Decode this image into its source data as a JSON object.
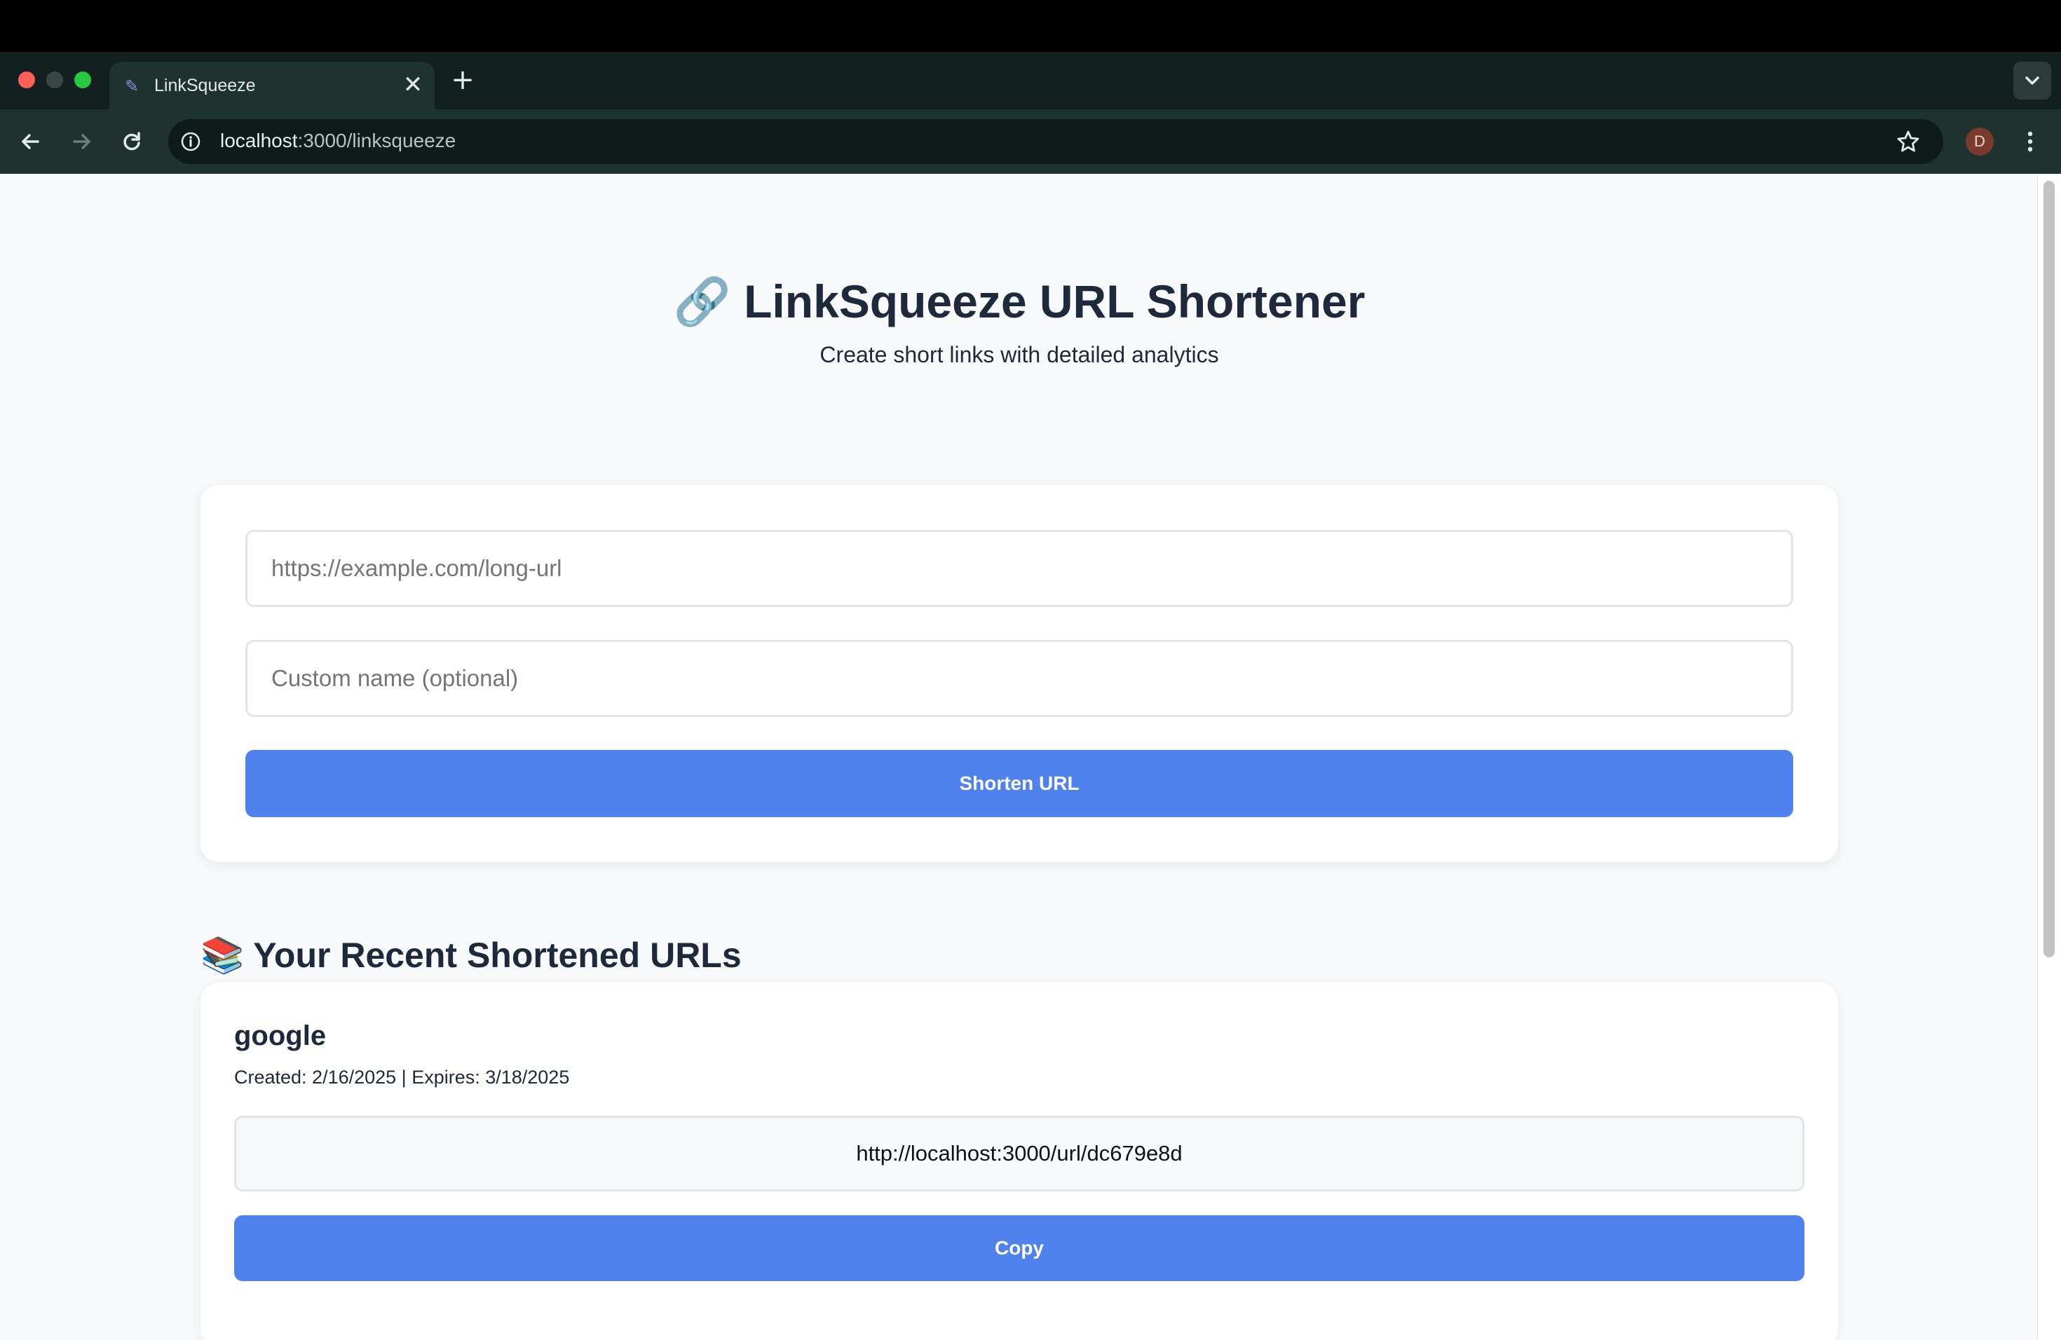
{
  "browser": {
    "tab_title": "LinkSqueeze",
    "new_tab_label": "+",
    "close_label": "✕",
    "url_host": "localhost",
    "url_rest": ":3000/linksqueeze",
    "profile_initial": "D"
  },
  "hero": {
    "emoji": "🔗",
    "title": "LinkSqueeze URL Shortener",
    "subtitle": "Create short links with detailed analytics"
  },
  "form": {
    "url_placeholder": "https://example.com/long-url",
    "name_placeholder": "Custom name (optional)",
    "submit_label": "Shorten URL"
  },
  "recent": {
    "emoji": "📚",
    "title": "Your Recent Shortened URLs",
    "items": [
      {
        "name": "google",
        "dates": "Created: 2/16/2025 | Expires: 3/18/2025",
        "short_url": "http://localhost:3000/url/dc679e8d",
        "copy_label": "Copy"
      }
    ]
  }
}
